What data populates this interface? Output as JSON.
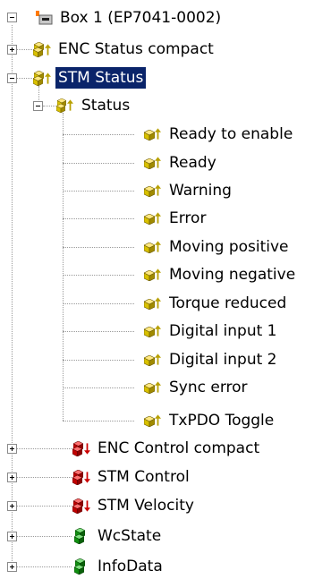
{
  "tree": {
    "box": {
      "label": "Box 1 (EP7041-0002)",
      "icon": "box-device-icon"
    },
    "enc_status_compact": {
      "label": "ENC Status compact",
      "icon": "input-group-icon"
    },
    "stm_status": {
      "label": "STM Status",
      "icon": "input-group-icon",
      "selected": true
    },
    "status": {
      "label": "Status",
      "icon": "input-variable-group-icon"
    },
    "status_items": [
      {
        "label": "Ready to enable",
        "icon": "input-variable-icon"
      },
      {
        "label": "Ready",
        "icon": "input-variable-icon"
      },
      {
        "label": "Warning",
        "icon": "input-variable-icon"
      },
      {
        "label": "Error",
        "icon": "input-variable-icon"
      },
      {
        "label": "Moving positive",
        "icon": "input-variable-icon"
      },
      {
        "label": "Moving negative",
        "icon": "input-variable-icon"
      },
      {
        "label": "Torque reduced",
        "icon": "input-variable-icon"
      },
      {
        "label": "Digital input 1",
        "icon": "input-variable-icon"
      },
      {
        "label": "Digital input 2",
        "icon": "input-variable-icon"
      },
      {
        "label": "Sync error",
        "icon": "input-variable-icon"
      },
      {
        "label": "TxPDO Toggle",
        "icon": "input-variable-icon"
      }
    ],
    "enc_control_compact": {
      "label": "ENC Control compact",
      "icon": "output-group-icon"
    },
    "stm_control": {
      "label": "STM Control",
      "icon": "output-group-icon"
    },
    "stm_velocity": {
      "label": "STM Velocity",
      "icon": "output-group-icon"
    },
    "wcstate": {
      "label": "WcState",
      "icon": "status-group-icon"
    },
    "infodata": {
      "label": "InfoData",
      "icon": "status-group-icon"
    }
  },
  "colors": {
    "selection_bg": "#0a246a",
    "selection_text": "#ffffff",
    "input_arrow": "#b8a000",
    "output_arrow": "#cc0000",
    "group_yellow": "#d8c000",
    "group_red": "#c00000",
    "group_green": "#109010"
  }
}
